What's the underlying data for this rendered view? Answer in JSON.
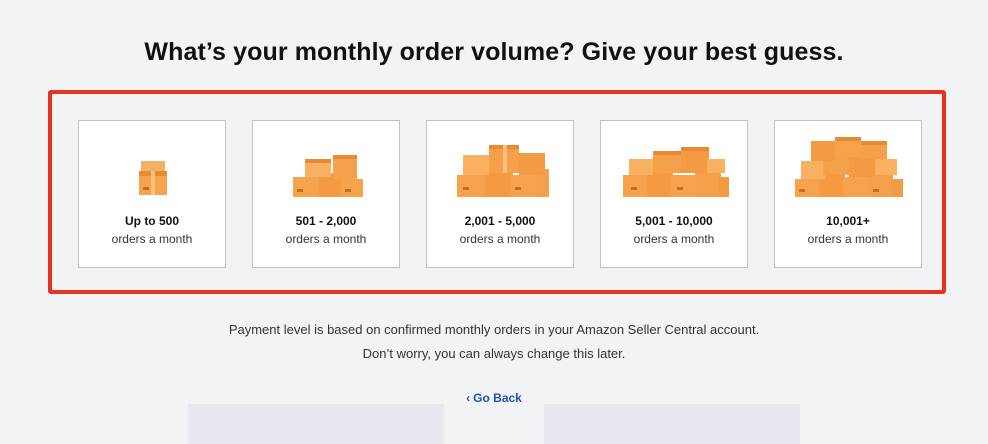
{
  "page": {
    "title": "What’s your monthly order volume? Give your best guess."
  },
  "options": [
    {
      "range": "Up to 500",
      "unit": "orders a month",
      "icon": "single-box-icon"
    },
    {
      "range": "501 - 2,000",
      "unit": "orders a month",
      "icon": "small-box-stack-icon"
    },
    {
      "range": "2,001 - 5,000",
      "unit": "orders a month",
      "icon": "medium-box-stack-icon"
    },
    {
      "range": "5,001 - 10,000",
      "unit": "orders a month",
      "icon": "large-box-stack-icon"
    },
    {
      "range": "10,001+",
      "unit": "orders a month",
      "icon": "huge-box-stack-icon"
    }
  ],
  "note": {
    "line1": "Payment level is based on confirmed monthly orders in your Amazon Seller Central account.",
    "line2": "Don’t worry, you can always change this later."
  },
  "nav": {
    "back_label": "Go Back",
    "back_icon": "chevron-left-icon"
  },
  "colors": {
    "highlight": "#e8321f",
    "box": "#f7a24d",
    "link": "#1f4fbf"
  }
}
